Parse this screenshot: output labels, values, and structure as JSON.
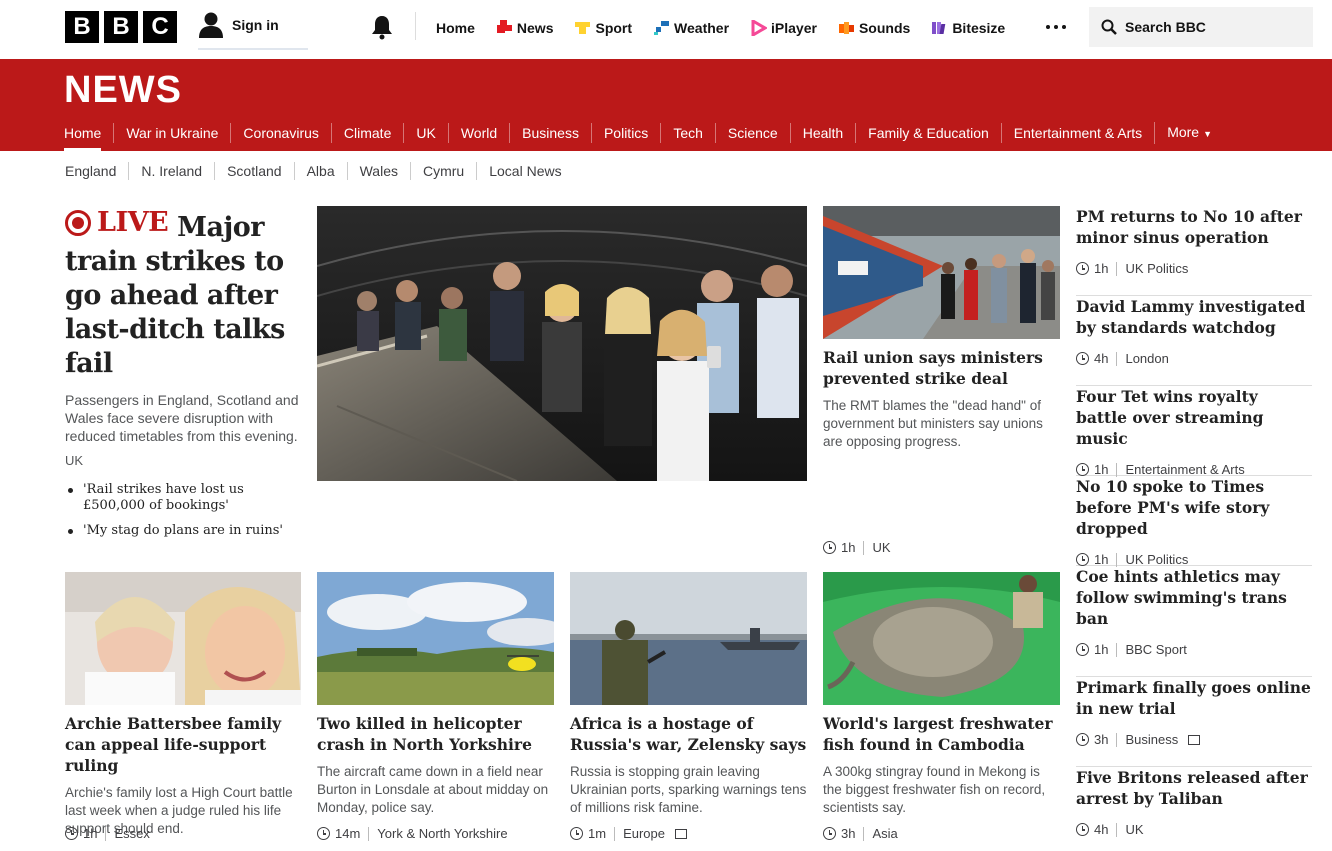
{
  "topbar": {
    "logo": [
      "B",
      "B",
      "C"
    ],
    "signin_label": "Sign in",
    "nav": [
      {
        "label": "Home",
        "icon": "none",
        "color": ""
      },
      {
        "label": "News",
        "icon": "news-icon",
        "color": "#e31b23"
      },
      {
        "label": "Sport",
        "icon": "sport-icon",
        "color": "#ffd230"
      },
      {
        "label": "Weather",
        "icon": "weather-icon",
        "color": "#1d70b8"
      },
      {
        "label": "iPlayer",
        "icon": "iplayer-icon",
        "color": "#f54997"
      },
      {
        "label": "Sounds",
        "icon": "sounds-icon",
        "color": "#ff6600"
      },
      {
        "label": "Bitesize",
        "icon": "bitesize-icon",
        "color": "#7f4fc9"
      }
    ],
    "search_placeholder": "Search BBC"
  },
  "news_header": {
    "title": "NEWS",
    "nav": [
      "Home",
      "War in Ukraine",
      "Coronavirus",
      "Climate",
      "UK",
      "World",
      "Business",
      "Politics",
      "Tech",
      "Science",
      "Health",
      "Family & Education",
      "Entertainment & Arts",
      "More"
    ]
  },
  "subnav": [
    "England",
    "N. Ireland",
    "Scotland",
    "Alba",
    "Wales",
    "Cymru",
    "Local News"
  ],
  "lead": {
    "live_label": "LIVE",
    "headline": "Major train strikes to go ahead after last-ditch talks fail",
    "summary": "Passengers in England, Scotland and Wales face severe disruption with reduced timetables from this evening.",
    "tag": "UK",
    "bullets": [
      "'Rail strikes have lost us £500,000 of bookings'",
      "'My stag do plans are in ruins'"
    ]
  },
  "rail_story": {
    "headline": "Rail union says ministers prevented strike deal",
    "summary": "The RMT blames the \"dead hand\" of government but ministers say unions are opposing progress.",
    "time": "1h",
    "tag": "UK"
  },
  "grid_stories": [
    {
      "headline": "Archie Battersbee family can appeal life-support ruling",
      "summary": "Archie's family lost a High Court battle last week when a judge ruled his life support should end.",
      "time": "1h",
      "tag": "Essex",
      "comments": false
    },
    {
      "headline": "Two killed in helicopter crash in North Yorkshire",
      "summary": "The aircraft came down in a field near Burton in Lonsdale at about midday on Monday, police say.",
      "time": "14m",
      "tag": "York & North Yorkshire",
      "comments": false
    },
    {
      "headline": "Africa is a hostage of Russia's war, Zelensky says",
      "summary": "Russia is stopping grain leaving Ukrainian ports, sparking warnings tens of millions risk famine.",
      "time": "1m",
      "tag": "Europe",
      "comments": true
    },
    {
      "headline": "World's largest freshwater fish found in Cambodia",
      "summary": "A 300kg stingray found in Mekong is the biggest freshwater fish on record, scientists say.",
      "time": "3h",
      "tag": "Asia",
      "comments": false
    }
  ],
  "sidebar": [
    {
      "headline": "PM returns to No 10 after minor sinus operation",
      "time": "1h",
      "tag": "UK Politics",
      "comments": false
    },
    {
      "headline": "David Lammy investigated by standards watchdog",
      "time": "4h",
      "tag": "London",
      "comments": false
    },
    {
      "headline": "Four Tet wins royalty battle over streaming music",
      "time": "1h",
      "tag": "Entertainment & Arts",
      "comments": false
    },
    {
      "headline": "No 10 spoke to Times before PM's wife story dropped",
      "time": "1h",
      "tag": "UK Politics",
      "comments": false
    },
    {
      "headline": "Coe hints athletics may follow swimming's trans ban",
      "time": "1h",
      "tag": "BBC Sport",
      "comments": false
    },
    {
      "headline": "Primark finally goes online in new trial",
      "time": "3h",
      "tag": "Business",
      "comments": true
    },
    {
      "headline": "Five Britons released after arrest by Taliban",
      "time": "4h",
      "tag": "UK",
      "comments": false
    }
  ],
  "colors": {
    "news_red": "#bb1919",
    "text": "#141414",
    "muted": "#545658"
  }
}
